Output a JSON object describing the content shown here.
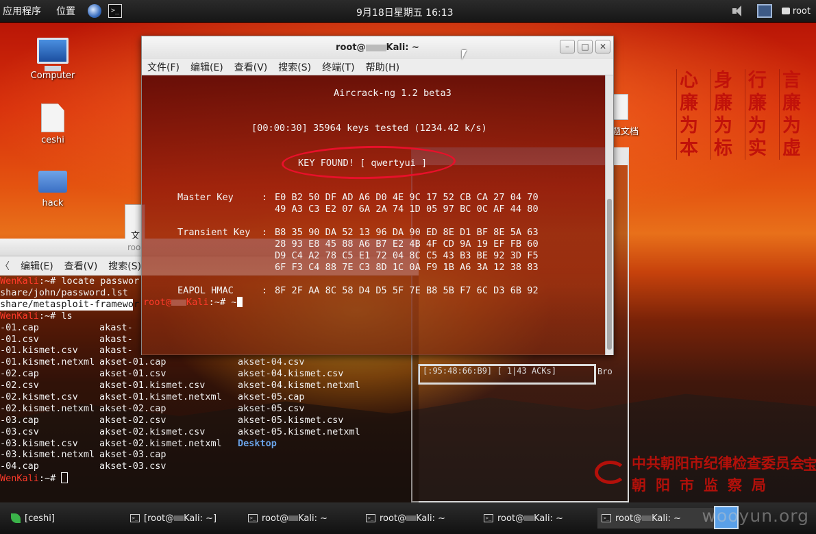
{
  "top_panel": {
    "applications": "应用程序",
    "places": "位置",
    "clock": "9月18日星期五 16:13",
    "user": "root"
  },
  "desktop": {
    "icons": [
      {
        "label": "Computer"
      },
      {
        "label": "ceshi"
      },
      {
        "label": "hack"
      }
    ],
    "partial_file_label": "题文档",
    "slogans": [
      [
        "言",
        "廉",
        "为",
        "虚"
      ],
      [
        "行",
        "廉",
        "为",
        "实"
      ],
      [
        "身",
        "廉",
        "为",
        "标"
      ],
      [
        "心",
        "廉",
        "为",
        "本"
      ]
    ],
    "emblem_line1": "中共朝阳市纪律检查委员会",
    "emblem_line2": "朝阳市监察局",
    "emblem_partial": "宝",
    "bg_small_window_text": "文",
    "bg_right_window_text": "[:95:48:66:B9] [ 1|43 ACKs]",
    "bg_right_window_partial": "Bro",
    "watermark": "wooyun.org"
  },
  "main_window": {
    "title": "root@",
    "title_suffix": "Kali: ~",
    "menu": [
      "文件(F)",
      "编辑(E)",
      "查看(V)",
      "搜索(S)",
      "终端(T)",
      "帮助(H)"
    ],
    "lines": {
      "header": "Aircrack-ng 1.2 beta3",
      "progress": "[00:00:30] 35964 keys tested (1234.42 k/s)",
      "key_found": "KEY FOUND! [ qwertyui ]",
      "master_label": "Master Key     :",
      "master_1": "E0 B2 50 DF AD A6 D0 4E 9C 17 52 CB CA 27 04 70",
      "master_2": "49 A3 C3 E2 07 6A 2A 74 1D 05 97 BC 0C AF 44 80",
      "transient_label": "Transient Key  :",
      "transient_1": "B8 35 90 DA 52 13 96 DA 90 ED 8E D1 BF 8E 5A 63",
      "transient_2": "28 93 E8 45 88 A6 B7 E2 4B 4F CD 9A 19 EF FB 60",
      "transient_3": "D9 C4 A2 78 C5 E1 72 04 8C C5 43 B3 BE 92 3D F5",
      "transient_4": "6F F3 C4 88 7E C3 8D 1C 0A F9 1B A6 3A 12 38 83",
      "eapol_label": "EAPOL HMAC     :",
      "eapol_1": "8F 2F AA 8C 58 D4 D5 5F 7E B8 5B F7 6C D3 6B 92",
      "prompt_user": "root@",
      "prompt_host": "Kali",
      "prompt_rest": ":~# ~"
    }
  },
  "left_terminal": {
    "title": "roo",
    "menu": [
      "编辑(E)",
      "查看(V)",
      "搜索(S)"
    ],
    "line1_host": "WenKali",
    "line1_cmd": ":~# locate passwor",
    "line2": "share/john/password.lst",
    "line3": "share/metasploit-framewor",
    "line4_host": "WenKali",
    "line4_cmd": ":~# ls",
    "ls_col1": [
      "-01.cap",
      "-01.csv",
      "-01.kismet.csv",
      "-01.kismet.netxml",
      "-02.cap",
      "-02.csv",
      "-02.kismet.csv",
      "-02.kismet.netxml",
      "-03.cap",
      "-03.csv",
      "-03.kismet.csv",
      "-03.kismet.netxml",
      "-04.cap"
    ],
    "ls_col2": [
      "akast-",
      "akast-",
      "akast-",
      "akset-01.cap",
      "akset-01.csv",
      "akset-01.kismet.csv",
      "akset-01.kismet.netxml",
      "akset-02.cap",
      "akset-02.csv",
      "akset-02.kismet.csv",
      "akset-02.kismet.netxml",
      "akset-03.cap",
      "akset-03.csv"
    ],
    "ls_col3": [
      "",
      "",
      "",
      "akset-04.csv",
      "akset-04.kismet.csv",
      "akset-04.kismet.netxml",
      "akset-05.cap",
      "akset-05.csv",
      "akset-05.kismet.csv",
      "akset-05.kismet.netxml",
      "Desktop",
      "",
      ""
    ],
    "last_host": "WenKali",
    "last_cmd": ":~# "
  },
  "taskbar": {
    "items": [
      "[ceshi]",
      "[root@",
      "root@",
      "root@",
      "root@",
      "root@"
    ],
    "suffixes": [
      "",
      "Kali: ~]",
      "Kali: ~",
      "Kali: ~",
      "Kali: ~",
      "Kali: ~"
    ]
  }
}
